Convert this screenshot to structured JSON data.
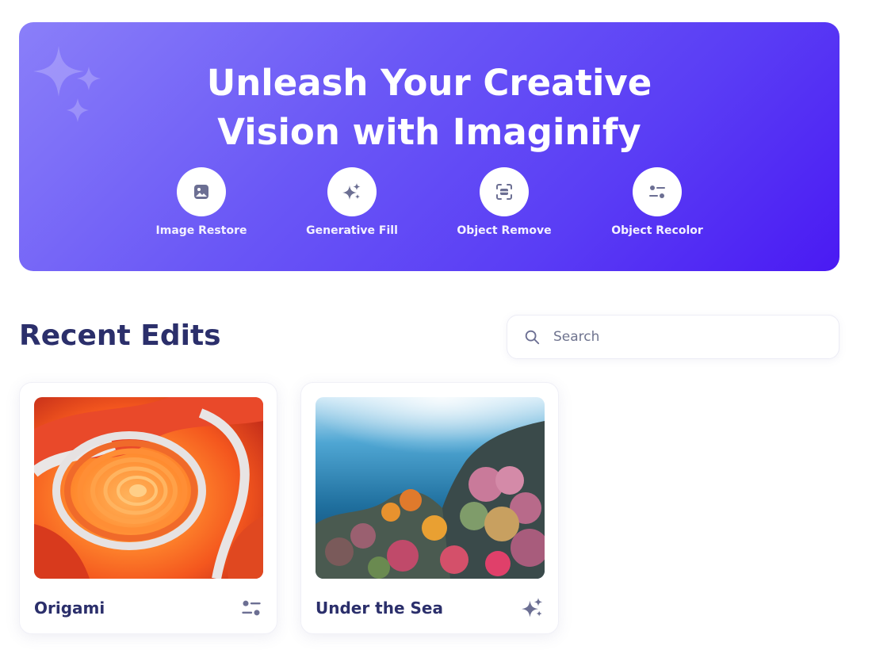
{
  "hero": {
    "title_line1": "Unleash Your Creative",
    "title_line2": "Vision with Imaginify",
    "tools": [
      {
        "label": "Image Restore",
        "icon": "image-icon"
      },
      {
        "label": "Generative Fill",
        "icon": "stars-icon"
      },
      {
        "label": "Object Remove",
        "icon": "scan-icon"
      },
      {
        "label": "Object Recolor",
        "icon": "filter-icon"
      }
    ]
  },
  "recent": {
    "title": "Recent Edits",
    "search_placeholder": "Search"
  },
  "cards": [
    {
      "title": "Origami",
      "icon": "filter-icon"
    },
    {
      "title": "Under the Sea",
      "icon": "stars-icon"
    }
  ],
  "colors": {
    "hero_gradient_start": "#8a7ff9",
    "hero_gradient_end": "#4a1af3",
    "heading": "#2b2f6b",
    "icon": "#6c6f93"
  }
}
